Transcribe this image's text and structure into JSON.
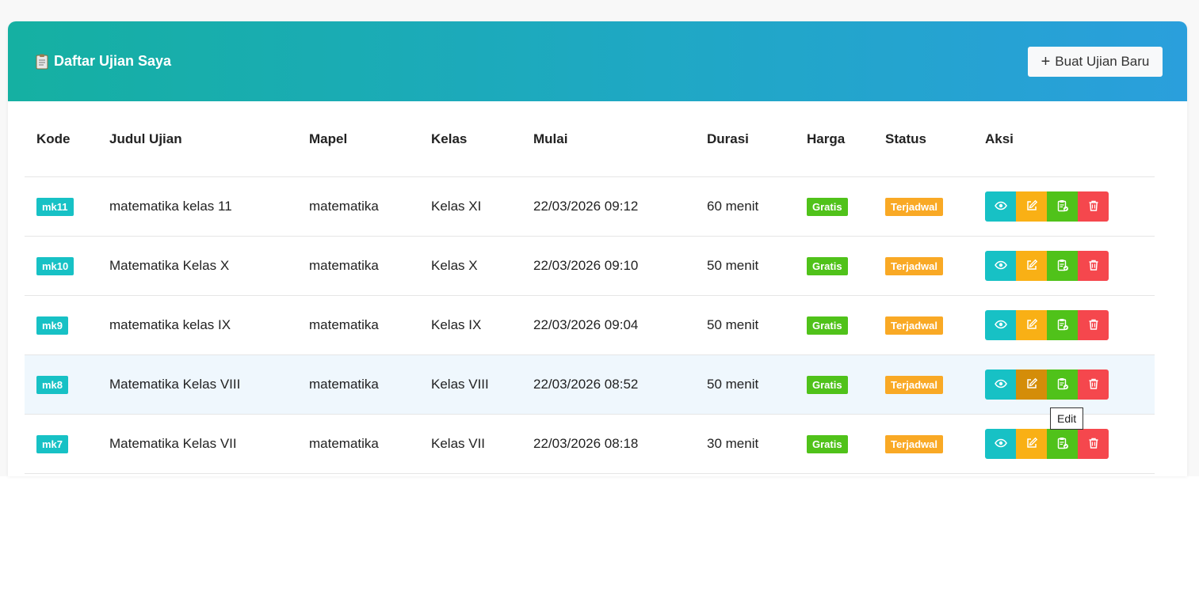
{
  "header": {
    "title": "Daftar Ujian Saya",
    "new_button": "Buat Ujian Baru"
  },
  "table": {
    "columns": [
      "Kode",
      "Judul Ujian",
      "Mapel",
      "Kelas",
      "Mulai",
      "Durasi",
      "Harga",
      "Status",
      "Aksi"
    ],
    "rows": [
      {
        "code": "mk11",
        "title": "matematika kelas 11",
        "subject": "matematika",
        "class": "Kelas XI",
        "start": "22/03/2026 09:12",
        "duration": "60 menit",
        "price": "Gratis",
        "status": "Terjadwal"
      },
      {
        "code": "mk10",
        "title": "Matematika Kelas X",
        "subject": "matematika",
        "class": "Kelas X",
        "start": "22/03/2026 09:10",
        "duration": "50 menit",
        "price": "Gratis",
        "status": "Terjadwal"
      },
      {
        "code": "mk9",
        "title": "matematika kelas IX",
        "subject": "matematika",
        "class": "Kelas IX",
        "start": "22/03/2026 09:04",
        "duration": "50 menit",
        "price": "Gratis",
        "status": "Terjadwal"
      },
      {
        "code": "mk8",
        "title": "Matematika Kelas VIII",
        "subject": "matematika",
        "class": "Kelas VIII",
        "start": "22/03/2026 08:52",
        "duration": "50 menit",
        "price": "Gratis",
        "status": "Terjadwal"
      },
      {
        "code": "mk7",
        "title": "Matematika Kelas VII",
        "subject": "matematika",
        "class": "Kelas VII",
        "start": "22/03/2026 08:18",
        "duration": "30 menit",
        "price": "Gratis",
        "status": "Terjadwal"
      }
    ]
  },
  "tooltip": {
    "text": "Edit"
  },
  "icons": {
    "header": "clipboard-icon",
    "view": "eye-icon",
    "edit": "edit-icon",
    "results": "clipboard-check-icon",
    "delete": "trash-icon"
  },
  "colors": {
    "header_start": "#15b0a2",
    "header_end": "#2a9fdc",
    "teal": "#17c1c5",
    "green": "#50c21a",
    "orange": "#f9a925",
    "red": "#f5474d"
  }
}
